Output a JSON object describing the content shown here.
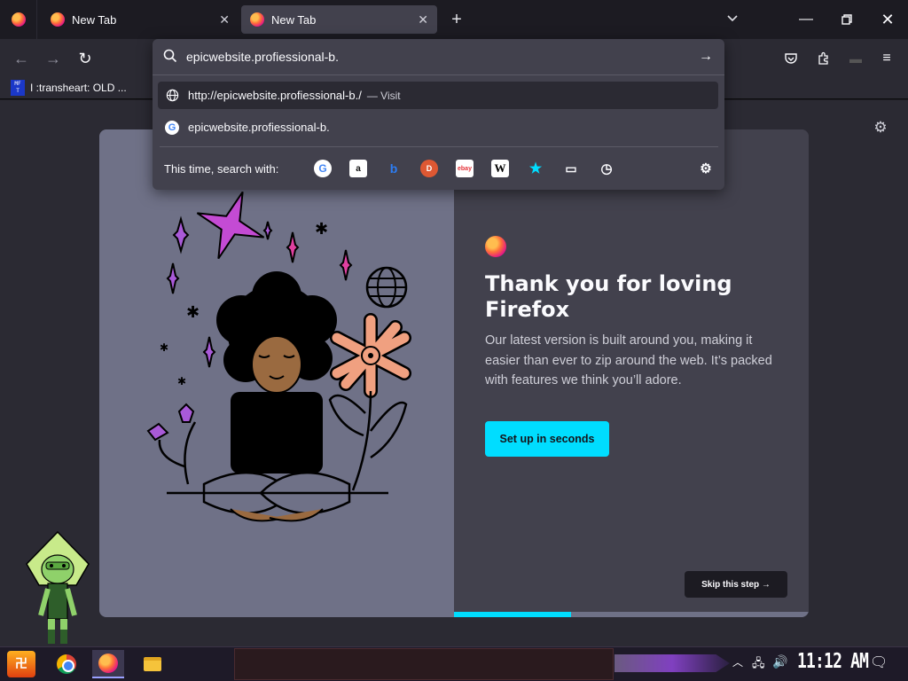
{
  "tabs": [
    {
      "title": "New Tab"
    },
    {
      "title": "New Tab"
    }
  ],
  "toolbar": {
    "new_tab_glyph": "+",
    "tab_list_glyph": "⌄",
    "back_glyph": "←",
    "forward_glyph": "→",
    "reload_glyph": "↻",
    "pocket_glyph": "♡",
    "extensions_glyph": "⧉",
    "menu_glyph": "≡"
  },
  "window": {
    "minimize": "—",
    "maximize": "▢",
    "close": "✕"
  },
  "bookmarks": [
    {
      "icon_text": "MF\nT",
      "label": "I :transheart: OLD ..."
    }
  ],
  "urlbar": {
    "value": "epicwebsite.profiessional-b.",
    "results": [
      {
        "icon": "globe-icon",
        "text": "http://epicwebsite.profiessional-b./",
        "action": "— Visit"
      },
      {
        "icon": "google-icon",
        "text": "epicwebsite.profiessional-b."
      }
    ],
    "oneoff_label": "This time, search with:",
    "engines": [
      {
        "name": "google",
        "glyph": "G"
      },
      {
        "name": "amazon",
        "glyph": "a"
      },
      {
        "name": "bing",
        "glyph": "b"
      },
      {
        "name": "duckduckgo",
        "glyph": "D"
      },
      {
        "name": "ebay",
        "glyph": "ebay"
      },
      {
        "name": "wikipedia",
        "glyph": "W"
      },
      {
        "name": "bookmarks",
        "glyph": "★"
      },
      {
        "name": "tabs",
        "glyph": "▭"
      },
      {
        "name": "history",
        "glyph": "◷"
      }
    ]
  },
  "onboarding": {
    "headline": "Thank you for loving Firefox",
    "description": "Our latest version is built around you, making it easier than ever to zip around the web. It’s packed with features we think you’ll adore.",
    "primary_button": "Set up in seconds",
    "skip_button": "Skip this step →",
    "progress": 0.33
  },
  "taskbar": {
    "start_glyph": "卍",
    "clock": "11:12 AM",
    "apps": [
      "chrome",
      "firefox",
      "file-explorer"
    ]
  },
  "colors": {
    "accent": "#00ddff",
    "card_left": "#6f7187",
    "card_right": "#42414d",
    "chrome_bg": "#2b2a33"
  }
}
